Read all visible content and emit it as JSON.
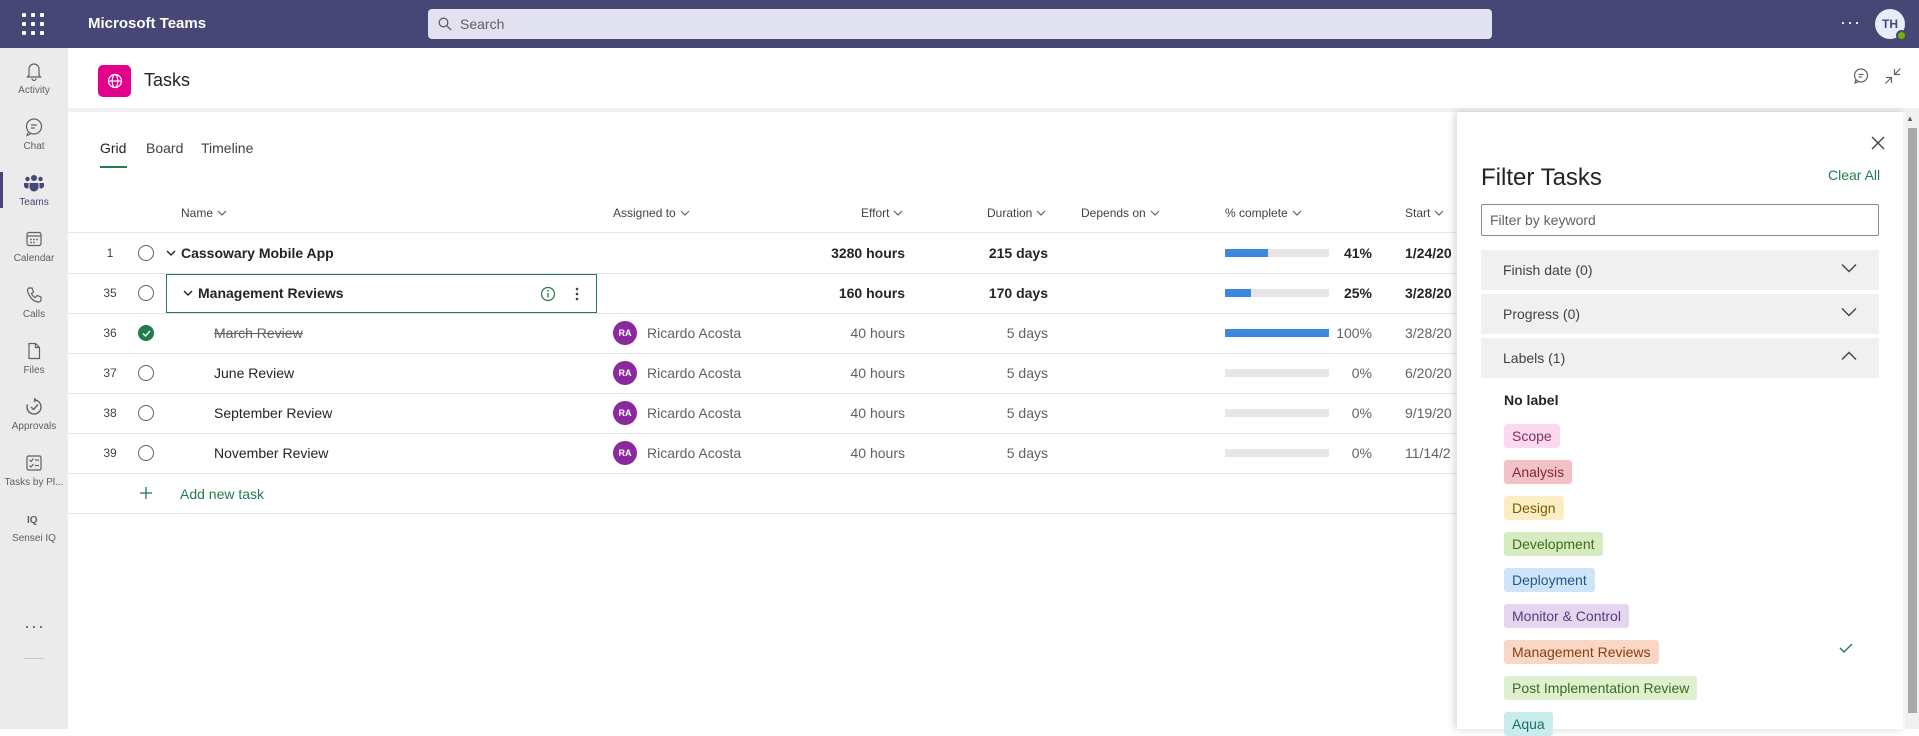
{
  "app": {
    "title": "Microsoft Teams",
    "search_placeholder": "Search",
    "more": "···",
    "user_initials": "TH"
  },
  "rail": {
    "items": [
      {
        "label": "Activity",
        "icon": "bell-icon"
      },
      {
        "label": "Chat",
        "icon": "chat-icon"
      },
      {
        "label": "Teams",
        "icon": "teams-icon",
        "active": true
      },
      {
        "label": "Calendar",
        "icon": "calendar-icon"
      },
      {
        "label": "Calls",
        "icon": "phone-icon"
      },
      {
        "label": "Files",
        "icon": "file-icon"
      },
      {
        "label": "Approvals",
        "icon": "approvals-icon"
      },
      {
        "label": "Tasks by Pl...",
        "icon": "tasks-icon"
      },
      {
        "label": "Sensei IQ",
        "icon": "sensei-icon"
      }
    ],
    "more": "···"
  },
  "header": {
    "title": "Tasks"
  },
  "tabs": [
    {
      "label": "Grid"
    },
    {
      "label": "Board"
    },
    {
      "label": "Timeline"
    }
  ],
  "columns": {
    "name": "Name",
    "assigned": "Assigned to",
    "effort": "Effort",
    "duration": "Duration",
    "depends": "Depends on",
    "complete": "% complete",
    "start": "Start"
  },
  "rows": [
    {
      "num": "1",
      "name": "Cassowary Mobile App",
      "assigned": "",
      "initials": "",
      "effort": "3280 hours",
      "duration": "215 days",
      "progress": 41,
      "pct": "41%",
      "start": "1/24/20",
      "level": 0,
      "bold": true,
      "done": false,
      "strike": false
    },
    {
      "num": "35",
      "name": "Management Reviews",
      "assigned": "",
      "initials": "",
      "effort": "160 hours",
      "duration": "170 days",
      "progress": 25,
      "pct": "25%",
      "start": "3/28/20",
      "level": 1,
      "bold": true,
      "done": false,
      "strike": false
    },
    {
      "num": "36",
      "name": "March Review",
      "assigned": "Ricardo Acosta",
      "initials": "RA",
      "effort": "40 hours",
      "duration": "5 days",
      "progress": 100,
      "pct": "100%",
      "start": "3/28/20",
      "level": 2,
      "bold": false,
      "done": true,
      "strike": true
    },
    {
      "num": "37",
      "name": "June Review",
      "assigned": "Ricardo Acosta",
      "initials": "RA",
      "effort": "40 hours",
      "duration": "5 days",
      "progress": 0,
      "pct": "0%",
      "start": "6/20/20",
      "level": 2,
      "bold": false,
      "done": false,
      "strike": false
    },
    {
      "num": "38",
      "name": "September Review",
      "assigned": "Ricardo Acosta",
      "initials": "RA",
      "effort": "40 hours",
      "duration": "5 days",
      "progress": 0,
      "pct": "0%",
      "start": "9/19/20",
      "level": 2,
      "bold": false,
      "done": false,
      "strike": false
    },
    {
      "num": "39",
      "name": "November Review",
      "assigned": "Ricardo Acosta",
      "initials": "RA",
      "effort": "40 hours",
      "duration": "5 days",
      "progress": 0,
      "pct": "0%",
      "start": "11/14/2",
      "level": 2,
      "bold": false,
      "done": false,
      "strike": false
    }
  ],
  "add_task": "Add new task",
  "filter": {
    "title": "Filter Tasks",
    "clear_all": "Clear All",
    "keyword_placeholder": "Filter by keyword",
    "sections": [
      "Finish date (0)",
      "Progress (0)",
      "Labels (1)"
    ],
    "no_label": "No label",
    "labels": [
      {
        "label": "Scope",
        "bg": "#fbd9ee",
        "fg": "#8a2a66"
      },
      {
        "label": "Analysis",
        "bg": "#f2c2c8",
        "fg": "#8a2533"
      },
      {
        "label": "Design",
        "bg": "#fbeec4",
        "fg": "#7a5d00"
      },
      {
        "label": "Development",
        "bg": "#d5ecc0",
        "fg": "#3f6b18"
      },
      {
        "label": "Deployment",
        "bg": "#cfe4f8",
        "fg": "#1d5a8c"
      },
      {
        "label": "Monitor & Control",
        "bg": "#e4d6ef",
        "fg": "#5a3a7a"
      },
      {
        "label": "Management Reviews",
        "bg": "#f9d7c4",
        "fg": "#8a3d12",
        "checked": true
      },
      {
        "label": "Post Implementation Review",
        "bg": "#def0d0",
        "fg": "#3e6a20"
      },
      {
        "label": "Aqua",
        "bg": "#c8ecec",
        "fg": "#1f6b6b"
      }
    ]
  }
}
